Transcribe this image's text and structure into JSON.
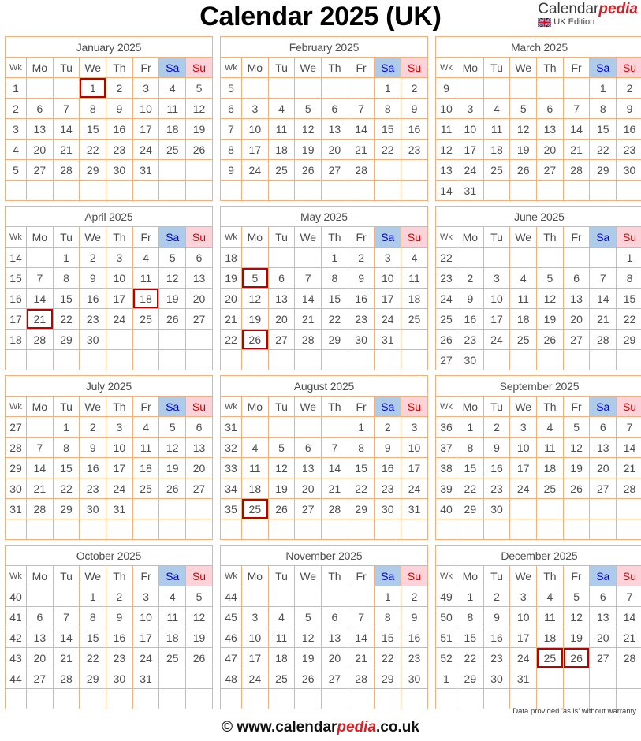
{
  "header": {
    "title": "Calendar 2025 (UK)",
    "brand_name_part1": "Calendar",
    "brand_name_part2": "pedia",
    "brand_edition": "UK Edition",
    "flag_icon": "uk-flag-icon"
  },
  "footer": {
    "copyright_prefix": "© www.calendar",
    "copyright_accent": "pedia",
    "copyright_suffix": ".co.uk",
    "disclaimer": "Data provided 'as is' without warranty"
  },
  "colors": {
    "title_text": "#cc0000",
    "title_bg": "#fdebd6",
    "header_bg": "#fbcfa6",
    "saturday_bg": "#aeccea",
    "saturday_text": "#0000cc",
    "sunday_bg": "#fbd3d9",
    "sunday_text": "#cc0000",
    "holiday_border": "#bb0000",
    "grid_border": "#f0b27c",
    "outer_border": "#e79a52",
    "weekday_text": "#4d4d4d",
    "brand_accent": "#d81f26"
  },
  "dow_labels": {
    "wk": "Wk",
    "mon": "Mo",
    "tue": "Tu",
    "wed": "We",
    "thu": "Th",
    "fri": "Fr",
    "sat": "Sa",
    "sun": "Su"
  },
  "year": 2025,
  "months": [
    {
      "name": "January 2025",
      "weeks": [
        {
          "wk": "1",
          "days": [
            "",
            "",
            "1",
            "2",
            "3",
            "4",
            "5"
          ]
        },
        {
          "wk": "2",
          "days": [
            "6",
            "7",
            "8",
            "9",
            "10",
            "11",
            "12"
          ]
        },
        {
          "wk": "3",
          "days": [
            "13",
            "14",
            "15",
            "16",
            "17",
            "18",
            "19"
          ]
        },
        {
          "wk": "4",
          "days": [
            "20",
            "21",
            "22",
            "23",
            "24",
            "25",
            "26"
          ]
        },
        {
          "wk": "5",
          "days": [
            "27",
            "28",
            "29",
            "30",
            "31",
            "",
            ""
          ]
        },
        {
          "wk": "",
          "days": [
            "",
            "",
            "",
            "",
            "",
            "",
            ""
          ]
        }
      ],
      "holidays": [
        "1"
      ]
    },
    {
      "name": "February 2025",
      "weeks": [
        {
          "wk": "5",
          "days": [
            "",
            "",
            "",
            "",
            "",
            "1",
            "2"
          ]
        },
        {
          "wk": "6",
          "days": [
            "3",
            "4",
            "5",
            "6",
            "7",
            "8",
            "9"
          ]
        },
        {
          "wk": "7",
          "days": [
            "10",
            "11",
            "12",
            "13",
            "14",
            "15",
            "16"
          ]
        },
        {
          "wk": "8",
          "days": [
            "17",
            "18",
            "19",
            "20",
            "21",
            "22",
            "23"
          ]
        },
        {
          "wk": "9",
          "days": [
            "24",
            "25",
            "26",
            "27",
            "28",
            "",
            ""
          ]
        },
        {
          "wk": "",
          "days": [
            "",
            "",
            "",
            "",
            "",
            "",
            ""
          ]
        }
      ],
      "holidays": []
    },
    {
      "name": "March 2025",
      "weeks": [
        {
          "wk": "9",
          "days": [
            "",
            "",
            "",
            "",
            "",
            "1",
            "2"
          ]
        },
        {
          "wk": "10",
          "days": [
            "3",
            "4",
            "5",
            "6",
            "7",
            "8",
            "9"
          ]
        },
        {
          "wk": "11",
          "days": [
            "10",
            "11",
            "12",
            "13",
            "14",
            "15",
            "16"
          ]
        },
        {
          "wk": "12",
          "days": [
            "17",
            "18",
            "19",
            "20",
            "21",
            "22",
            "23"
          ]
        },
        {
          "wk": "13",
          "days": [
            "24",
            "25",
            "26",
            "27",
            "28",
            "29",
            "30"
          ]
        },
        {
          "wk": "14",
          "days": [
            "31",
            "",
            "",
            "",
            "",
            "",
            ""
          ]
        }
      ],
      "holidays": []
    },
    {
      "name": "April 2025",
      "weeks": [
        {
          "wk": "14",
          "days": [
            "",
            "1",
            "2",
            "3",
            "4",
            "5",
            "6"
          ]
        },
        {
          "wk": "15",
          "days": [
            "7",
            "8",
            "9",
            "10",
            "11",
            "12",
            "13"
          ]
        },
        {
          "wk": "16",
          "days": [
            "14",
            "15",
            "16",
            "17",
            "18",
            "19",
            "20"
          ]
        },
        {
          "wk": "17",
          "days": [
            "21",
            "22",
            "23",
            "24",
            "25",
            "26",
            "27"
          ]
        },
        {
          "wk": "18",
          "days": [
            "28",
            "29",
            "30",
            "",
            "",
            "",
            ""
          ]
        },
        {
          "wk": "",
          "days": [
            "",
            "",
            "",
            "",
            "",
            "",
            ""
          ]
        }
      ],
      "holidays": [
        "18",
        "21"
      ]
    },
    {
      "name": "May 2025",
      "weeks": [
        {
          "wk": "18",
          "days": [
            "",
            "",
            "",
            "1",
            "2",
            "3",
            "4"
          ]
        },
        {
          "wk": "19",
          "days": [
            "5",
            "6",
            "7",
            "8",
            "9",
            "10",
            "11"
          ]
        },
        {
          "wk": "20",
          "days": [
            "12",
            "13",
            "14",
            "15",
            "16",
            "17",
            "18"
          ]
        },
        {
          "wk": "21",
          "days": [
            "19",
            "20",
            "21",
            "22",
            "23",
            "24",
            "25"
          ]
        },
        {
          "wk": "22",
          "days": [
            "26",
            "27",
            "28",
            "29",
            "30",
            "31",
            ""
          ]
        },
        {
          "wk": "",
          "days": [
            "",
            "",
            "",
            "",
            "",
            "",
            ""
          ]
        }
      ],
      "holidays": [
        "5",
        "26"
      ]
    },
    {
      "name": "June 2025",
      "weeks": [
        {
          "wk": "22",
          "days": [
            "",
            "",
            "",
            "",
            "",
            "",
            "1"
          ]
        },
        {
          "wk": "23",
          "days": [
            "2",
            "3",
            "4",
            "5",
            "6",
            "7",
            "8"
          ]
        },
        {
          "wk": "24",
          "days": [
            "9",
            "10",
            "11",
            "12",
            "13",
            "14",
            "15"
          ]
        },
        {
          "wk": "25",
          "days": [
            "16",
            "17",
            "18",
            "19",
            "20",
            "21",
            "22"
          ]
        },
        {
          "wk": "26",
          "days": [
            "23",
            "24",
            "25",
            "26",
            "27",
            "28",
            "29"
          ]
        },
        {
          "wk": "27",
          "days": [
            "30",
            "",
            "",
            "",
            "",
            "",
            ""
          ]
        }
      ],
      "holidays": []
    },
    {
      "name": "July 2025",
      "weeks": [
        {
          "wk": "27",
          "days": [
            "",
            "1",
            "2",
            "3",
            "4",
            "5",
            "6"
          ]
        },
        {
          "wk": "28",
          "days": [
            "7",
            "8",
            "9",
            "10",
            "11",
            "12",
            "13"
          ]
        },
        {
          "wk": "29",
          "days": [
            "14",
            "15",
            "16",
            "17",
            "18",
            "19",
            "20"
          ]
        },
        {
          "wk": "30",
          "days": [
            "21",
            "22",
            "23",
            "24",
            "25",
            "26",
            "27"
          ]
        },
        {
          "wk": "31",
          "days": [
            "28",
            "29",
            "30",
            "31",
            "",
            "",
            ""
          ]
        },
        {
          "wk": "",
          "days": [
            "",
            "",
            "",
            "",
            "",
            "",
            ""
          ]
        }
      ],
      "holidays": []
    },
    {
      "name": "August 2025",
      "weeks": [
        {
          "wk": "31",
          "days": [
            "",
            "",
            "",
            "",
            "1",
            "2",
            "3"
          ]
        },
        {
          "wk": "32",
          "days": [
            "4",
            "5",
            "6",
            "7",
            "8",
            "9",
            "10"
          ]
        },
        {
          "wk": "33",
          "days": [
            "11",
            "12",
            "13",
            "14",
            "15",
            "16",
            "17"
          ]
        },
        {
          "wk": "34",
          "days": [
            "18",
            "19",
            "20",
            "21",
            "22",
            "23",
            "24"
          ]
        },
        {
          "wk": "35",
          "days": [
            "25",
            "26",
            "27",
            "28",
            "29",
            "30",
            "31"
          ]
        },
        {
          "wk": "",
          "days": [
            "",
            "",
            "",
            "",
            "",
            "",
            ""
          ]
        }
      ],
      "holidays": [
        "25"
      ]
    },
    {
      "name": "September 2025",
      "weeks": [
        {
          "wk": "36",
          "days": [
            "1",
            "2",
            "3",
            "4",
            "5",
            "6",
            "7"
          ]
        },
        {
          "wk": "37",
          "days": [
            "8",
            "9",
            "10",
            "11",
            "12",
            "13",
            "14"
          ]
        },
        {
          "wk": "38",
          "days": [
            "15",
            "16",
            "17",
            "18",
            "19",
            "20",
            "21"
          ]
        },
        {
          "wk": "39",
          "days": [
            "22",
            "23",
            "24",
            "25",
            "26",
            "27",
            "28"
          ]
        },
        {
          "wk": "40",
          "days": [
            "29",
            "30",
            "",
            "",
            "",
            "",
            ""
          ]
        },
        {
          "wk": "",
          "days": [
            "",
            "",
            "",
            "",
            "",
            "",
            ""
          ]
        }
      ],
      "holidays": []
    },
    {
      "name": "October 2025",
      "weeks": [
        {
          "wk": "40",
          "days": [
            "",
            "",
            "1",
            "2",
            "3",
            "4",
            "5"
          ]
        },
        {
          "wk": "41",
          "days": [
            "6",
            "7",
            "8",
            "9",
            "10",
            "11",
            "12"
          ]
        },
        {
          "wk": "42",
          "days": [
            "13",
            "14",
            "15",
            "16",
            "17",
            "18",
            "19"
          ]
        },
        {
          "wk": "43",
          "days": [
            "20",
            "21",
            "22",
            "23",
            "24",
            "25",
            "26"
          ]
        },
        {
          "wk": "44",
          "days": [
            "27",
            "28",
            "29",
            "30",
            "31",
            "",
            ""
          ]
        },
        {
          "wk": "",
          "days": [
            "",
            "",
            "",
            "",
            "",
            "",
            ""
          ]
        }
      ],
      "holidays": []
    },
    {
      "name": "November 2025",
      "weeks": [
        {
          "wk": "44",
          "days": [
            "",
            "",
            "",
            "",
            "",
            "1",
            "2"
          ]
        },
        {
          "wk": "45",
          "days": [
            "3",
            "4",
            "5",
            "6",
            "7",
            "8",
            "9"
          ]
        },
        {
          "wk": "46",
          "days": [
            "10",
            "11",
            "12",
            "13",
            "14",
            "15",
            "16"
          ]
        },
        {
          "wk": "47",
          "days": [
            "17",
            "18",
            "19",
            "20",
            "21",
            "22",
            "23"
          ]
        },
        {
          "wk": "48",
          "days": [
            "24",
            "25",
            "26",
            "27",
            "28",
            "29",
            "30"
          ]
        },
        {
          "wk": "",
          "days": [
            "",
            "",
            "",
            "",
            "",
            "",
            ""
          ]
        }
      ],
      "holidays": []
    },
    {
      "name": "December 2025",
      "weeks": [
        {
          "wk": "49",
          "days": [
            "1",
            "2",
            "3",
            "4",
            "5",
            "6",
            "7"
          ]
        },
        {
          "wk": "50",
          "days": [
            "8",
            "9",
            "10",
            "11",
            "12",
            "13",
            "14"
          ]
        },
        {
          "wk": "51",
          "days": [
            "15",
            "16",
            "17",
            "18",
            "19",
            "20",
            "21"
          ]
        },
        {
          "wk": "52",
          "days": [
            "22",
            "23",
            "24",
            "25",
            "26",
            "27",
            "28"
          ]
        },
        {
          "wk": "1",
          "days": [
            "29",
            "30",
            "31",
            "",
            "",
            "",
            ""
          ]
        },
        {
          "wk": "",
          "days": [
            "",
            "",
            "",
            "",
            "",
            "",
            ""
          ]
        }
      ],
      "holidays": [
        "25",
        "26"
      ]
    }
  ]
}
